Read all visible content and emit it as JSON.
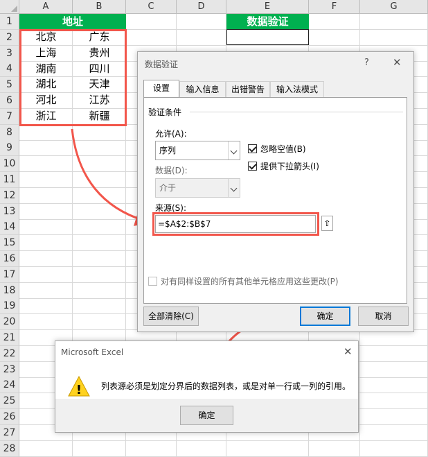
{
  "sheet": {
    "columns": [
      "A",
      "B",
      "C",
      "D",
      "E",
      "F",
      "G"
    ],
    "rows": [
      "1",
      "2",
      "3",
      "4",
      "5",
      "6",
      "7",
      "8",
      "9",
      "10",
      "11",
      "12",
      "13",
      "14",
      "15",
      "16",
      "17",
      "18",
      "19",
      "20",
      "21",
      "22",
      "23",
      "24",
      "25",
      "26",
      "27",
      "28"
    ],
    "a1_header": "地址",
    "e1_header": "数据验证",
    "col_a": [
      "北京",
      "上海",
      "湖南",
      "湖北",
      "河北",
      "浙江"
    ],
    "col_b": [
      "广东",
      "贵州",
      "四川",
      "天津",
      "江苏",
      "新疆"
    ]
  },
  "validation_dialog": {
    "title": "数据验证",
    "help_icon": "?",
    "close_icon": "✕",
    "tabs": [
      "设置",
      "输入信息",
      "出错警告",
      "输入法模式"
    ],
    "group_label": "验证条件",
    "allow_label": "允许(A):",
    "allow_value": "序列",
    "data_label": "数据(D):",
    "data_value": "介于",
    "ignore_blank": "忽略空值(B)",
    "in_cell_dropdown": "提供下拉箭头(I)",
    "source_label": "来源(S):",
    "source_value": "=$A$2:$B$7",
    "apply_all": "对有同样设置的所有其他单元格应用这些更改(P)",
    "clear_all": "全部清除(C)",
    "ok": "确定",
    "cancel": "取消"
  },
  "error_dialog": {
    "title": "Microsoft Excel",
    "message": "列表源必须是划定分界后的数据列表，或是对单一行或一列的引用。",
    "ok": "确定",
    "close_icon": "✕",
    "warning_glyph": "!"
  },
  "colors": {
    "header_green": "#00b050",
    "annotation_red": "#f2564b",
    "accent_blue": "#0078d7"
  }
}
